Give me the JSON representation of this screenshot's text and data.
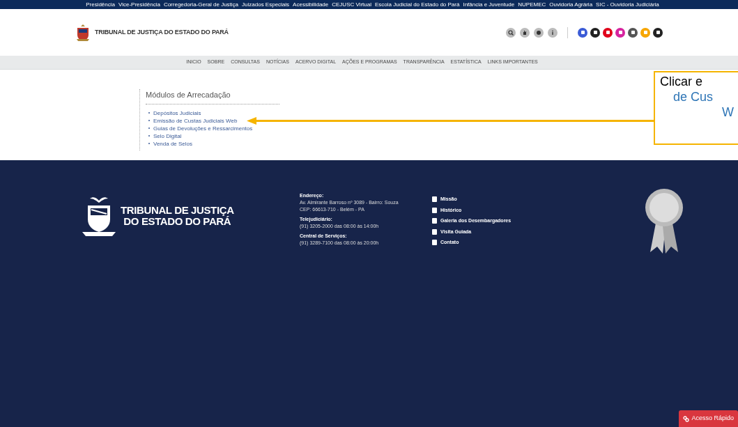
{
  "top_links": [
    "Presidência",
    "Vice-Presidência",
    "Corregedoria-Geral de Justiça",
    "Juizados Especiais",
    "Acessibilidade",
    "CEJUSC Virtual",
    "Escola Judicial do Estado do Pará",
    "Infância e Juventude",
    "NUPEMEC",
    "Ouvidoria Agrária",
    "SIC - Ouvidoria Judiciária"
  ],
  "header": {
    "title": "TRIBUNAL DE JUSTIÇA DO ESTADO DO PARÁ"
  },
  "social": [
    {
      "color": "#3b5bd6"
    },
    {
      "color": "#222222"
    },
    {
      "color": "#e0001b"
    },
    {
      "color": "#d6249f"
    },
    {
      "color": "#555555"
    },
    {
      "color": "#f7a600"
    },
    {
      "color": "#222222"
    }
  ],
  "nav": [
    "INICIO",
    "SOBRE",
    "CONSULTAS",
    "NOTÍCIAS",
    "ACERVO DIGITAL",
    "AÇÕES E PROGRAMAS",
    "TRANSPARÊNCIA",
    "ESTATÍSTICA",
    "LINKS IMPORTANTES"
  ],
  "modules": {
    "title": "Módulos de Arrecadação",
    "items": [
      "Depósitos Judiciais",
      "Emissão de Custas Judiciais Web",
      "Guias de Devoluções e Ressarcimentos",
      "Selo Digital",
      "Venda de Selos"
    ]
  },
  "callout": {
    "lines": [
      "Clicar e",
      "de Cus",
      "W"
    ]
  },
  "footer": {
    "logo_lines": [
      "TRIBUNAL DE JUSTIÇA",
      "DO ESTADO DO PARÁ"
    ],
    "contacts": [
      {
        "heading": "Endereço:",
        "lines": [
          "Av. Almirante Barroso nº 3089 - Bairro: Souza",
          "CEP: 66613-710 - Belém - PA"
        ]
      },
      {
        "heading": "Telejudiciário:",
        "lines": [
          "(91) 3205-2000 das 08:00 às 14:00h"
        ]
      },
      {
        "heading": "Central de Serviços:",
        "lines": [
          "(91) 3289-7100 das 08:00 às 20:00h"
        ]
      }
    ],
    "links": [
      "Missão",
      "Histórico",
      "Galeria dos Desembargadores",
      "Visita Guiada",
      "Contato"
    ],
    "quick_access": "Acesso Rápido"
  }
}
